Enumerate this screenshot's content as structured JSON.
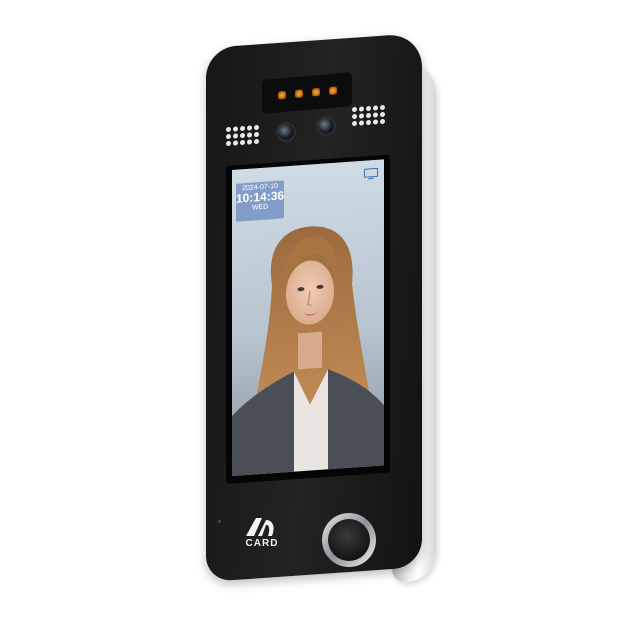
{
  "device": {
    "screen": {
      "date": "2024-07-10",
      "time": "10:14:36",
      "weekday": "WED"
    },
    "label": "CARD",
    "icons": {
      "monitor": "monitor-icon",
      "logo": "brand-logo-icon",
      "fingerprint": "fingerprint-sensor-icon",
      "camera": "camera-icon",
      "speaker": "speaker-grille-icon"
    },
    "colors": {
      "body": "#1b1b1b",
      "ir_leds": "#e08a1e",
      "datetime_panel": "#5577b0"
    }
  }
}
